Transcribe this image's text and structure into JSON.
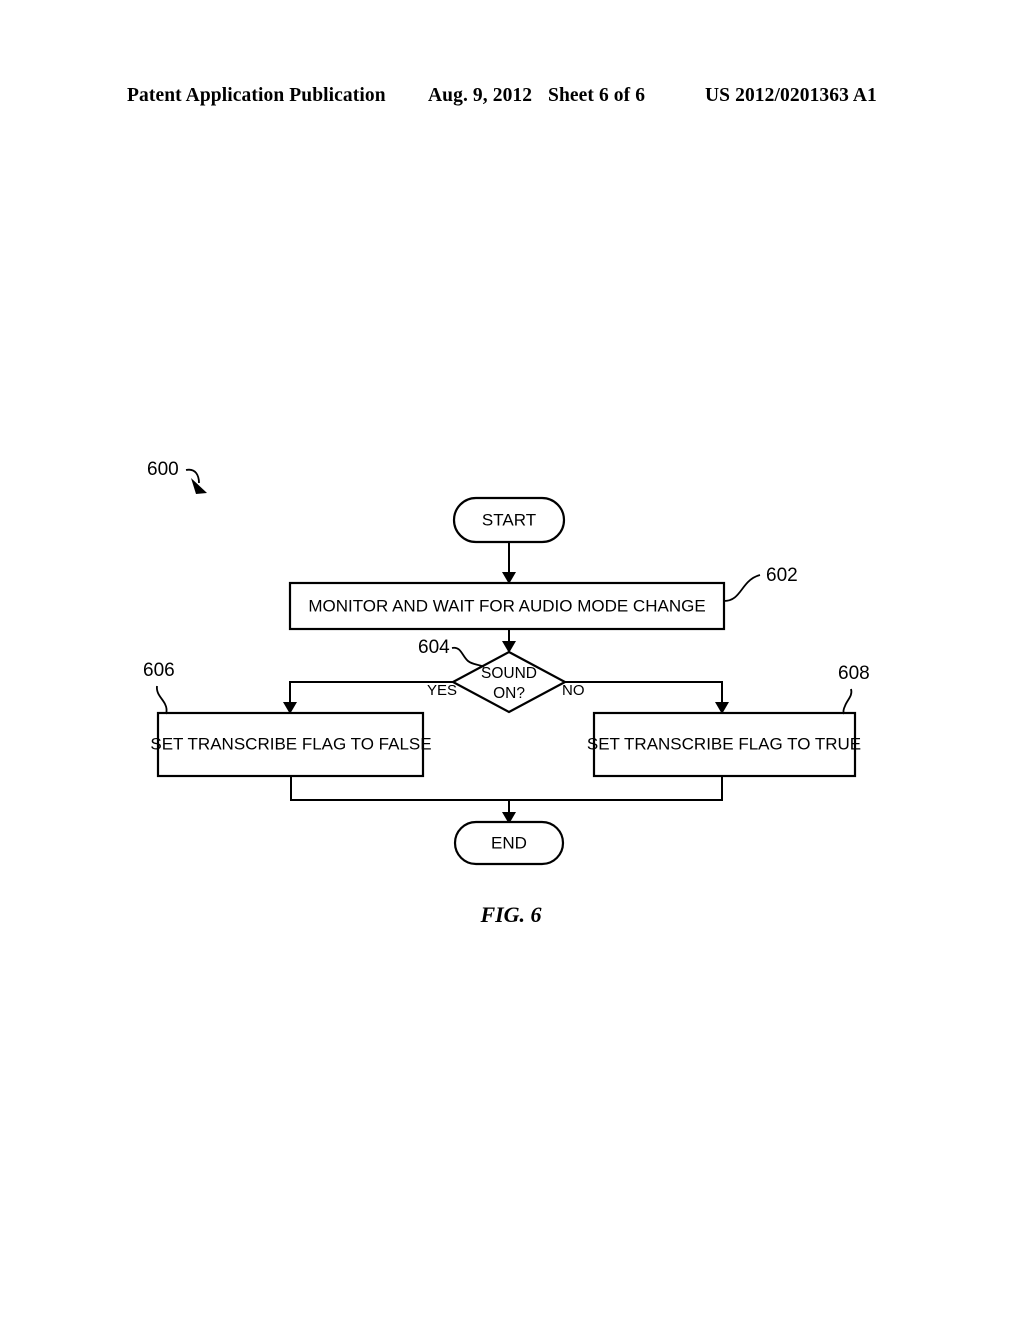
{
  "header": {
    "publication": "Patent Application Publication",
    "date": "Aug. 9, 2012",
    "sheet": "Sheet 6 of 6",
    "patent_number": "US 2012/0201363 A1"
  },
  "figure": {
    "caption": "FIG. 6",
    "diagram_reference": "600",
    "nodes": {
      "start": "START",
      "monitor": "MONITOR AND WAIT FOR AUDIO MODE  CHANGE",
      "decision_line1": "SOUND",
      "decision_line2": "ON?",
      "set_false": "SET TRANSCRIBE FLAG TO FALSE",
      "set_true": "SET TRANSCRIBE FLAG TO TRUE",
      "end": "END"
    },
    "reference_numerals": {
      "monitor": "602",
      "decision": "604",
      "set_false": "606",
      "set_true": "608"
    },
    "branch_labels": {
      "yes": "YES",
      "no": "NO"
    }
  }
}
